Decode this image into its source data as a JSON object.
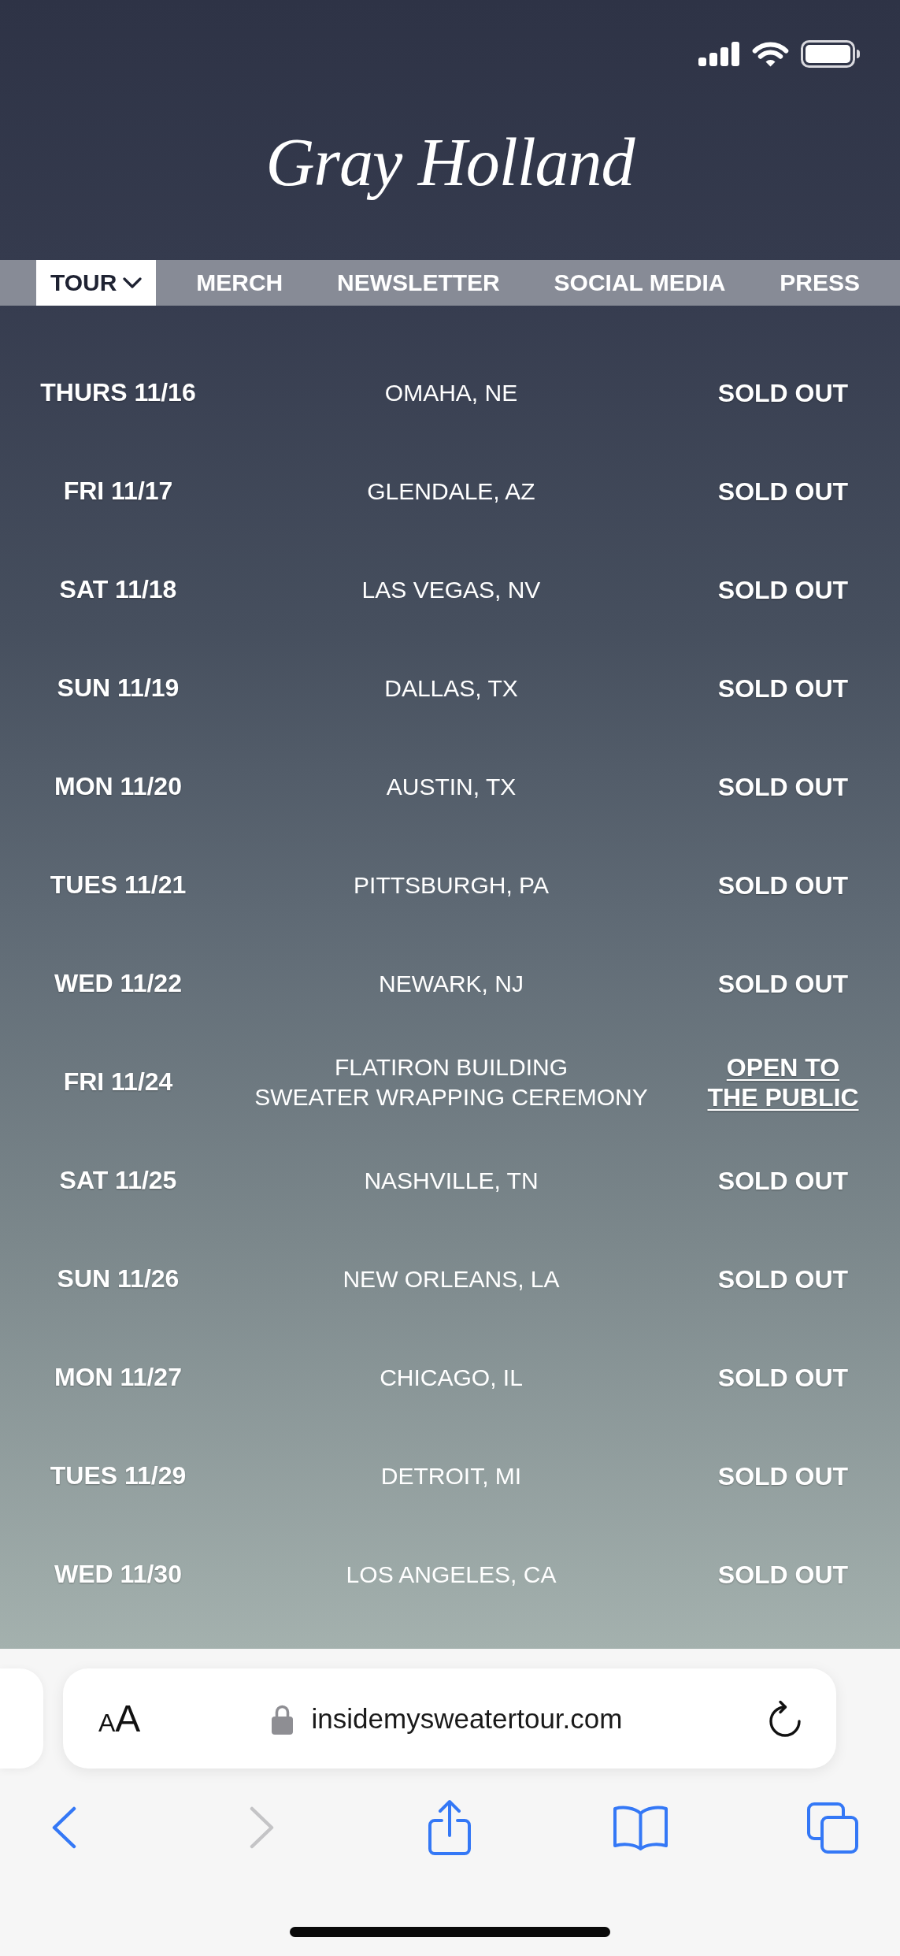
{
  "site": {
    "logo": "Gray Holland",
    "nav": [
      {
        "label": "TOUR",
        "selected": true,
        "has_menu": true
      },
      {
        "label": "MERCH",
        "selected": false,
        "has_menu": false
      },
      {
        "label": "NEWSLETTER",
        "selected": false,
        "has_menu": false
      },
      {
        "label": "SOCIAL MEDIA",
        "selected": false,
        "has_menu": false
      },
      {
        "label": "PRESS",
        "selected": false,
        "has_menu": false
      }
    ]
  },
  "tour_dates": [
    {
      "date": "THURS 11/16",
      "venue": [
        "OMAHA, NE"
      ],
      "kind": "sold_out",
      "status": [
        "SOLD OUT"
      ]
    },
    {
      "date": "FRI 11/17",
      "venue": [
        "GLENDALE, AZ"
      ],
      "kind": "sold_out",
      "status": [
        "SOLD OUT"
      ]
    },
    {
      "date": "SAT 11/18",
      "venue": [
        "LAS VEGAS, NV"
      ],
      "kind": "sold_out",
      "status": [
        "SOLD OUT"
      ]
    },
    {
      "date": "SUN 11/19",
      "venue": [
        "DALLAS, TX"
      ],
      "kind": "sold_out",
      "status": [
        "SOLD OUT"
      ]
    },
    {
      "date": "MON 11/20",
      "venue": [
        "AUSTIN, TX"
      ],
      "kind": "sold_out",
      "status": [
        "SOLD OUT"
      ]
    },
    {
      "date": "TUES 11/21",
      "venue": [
        "PITTSBURGH, PA"
      ],
      "kind": "sold_out",
      "status": [
        "SOLD OUT"
      ]
    },
    {
      "date": "WED 11/22",
      "venue": [
        "NEWARK, NJ"
      ],
      "kind": "sold_out",
      "status": [
        "SOLD OUT"
      ]
    },
    {
      "date": "FRI 11/24",
      "venue": [
        "FLATIRON BUILDING",
        "SWEATER WRAPPING CEREMONY"
      ],
      "kind": "link",
      "status": [
        "OPEN TO",
        "THE PUBLIC"
      ]
    },
    {
      "date": "SAT 11/25",
      "venue": [
        "NASHVILLE, TN"
      ],
      "kind": "sold_out",
      "status": [
        "SOLD OUT"
      ]
    },
    {
      "date": "SUN 11/26",
      "venue": [
        "NEW ORLEANS, LA"
      ],
      "kind": "sold_out",
      "status": [
        "SOLD OUT"
      ]
    },
    {
      "date": "MON 11/27",
      "venue": [
        "CHICAGO, IL"
      ],
      "kind": "sold_out",
      "status": [
        "SOLD OUT"
      ]
    },
    {
      "date": "TUES 11/29",
      "venue": [
        "DETROIT, MI"
      ],
      "kind": "sold_out",
      "status": [
        "SOLD OUT"
      ]
    },
    {
      "date": "WED 11/30",
      "venue": [
        "LOS ANGELES, CA"
      ],
      "kind": "sold_out",
      "status": [
        "SOLD OUT"
      ]
    }
  ],
  "browser": {
    "text_size_button": "AA",
    "url": "insidemysweatertour.com",
    "toolbar": [
      {
        "kind": "back",
        "disabled": false
      },
      {
        "kind": "forward",
        "disabled": true
      },
      {
        "kind": "share",
        "disabled": false
      },
      {
        "kind": "bookmarks",
        "disabled": false
      },
      {
        "kind": "tabs",
        "disabled": false
      }
    ]
  }
}
